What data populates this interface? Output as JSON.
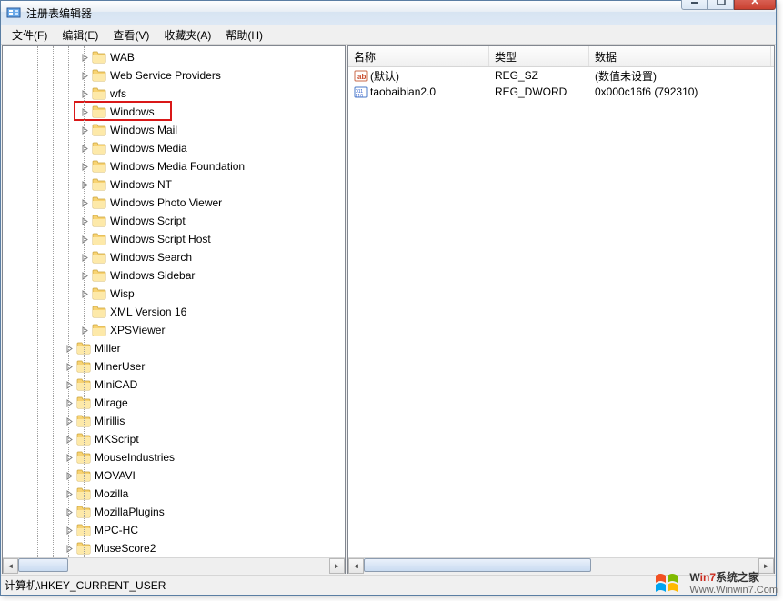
{
  "window": {
    "title": "注册表编辑器"
  },
  "menu": {
    "file": "文件(F)",
    "edit": "编辑(E)",
    "view": "查看(V)",
    "favorites": "收藏夹(A)",
    "help": "帮助(H)"
  },
  "tree": {
    "items": [
      {
        "indent": 85,
        "label": "WAB",
        "expandable": true
      },
      {
        "indent": 85,
        "label": "Web Service Providers",
        "expandable": true
      },
      {
        "indent": 85,
        "label": "wfs",
        "expandable": true
      },
      {
        "indent": 85,
        "label": "Windows",
        "expandable": true,
        "highlighted": true
      },
      {
        "indent": 85,
        "label": "Windows Mail",
        "expandable": true
      },
      {
        "indent": 85,
        "label": "Windows Media",
        "expandable": true
      },
      {
        "indent": 85,
        "label": "Windows Media Foundation",
        "expandable": true
      },
      {
        "indent": 85,
        "label": "Windows NT",
        "expandable": true
      },
      {
        "indent": 85,
        "label": "Windows Photo Viewer",
        "expandable": true
      },
      {
        "indent": 85,
        "label": "Windows Script",
        "expandable": true
      },
      {
        "indent": 85,
        "label": "Windows Script Host",
        "expandable": true
      },
      {
        "indent": 85,
        "label": "Windows Search",
        "expandable": true
      },
      {
        "indent": 85,
        "label": "Windows Sidebar",
        "expandable": true
      },
      {
        "indent": 85,
        "label": "Wisp",
        "expandable": true
      },
      {
        "indent": 85,
        "label": "XML Version 16",
        "expandable": false
      },
      {
        "indent": 85,
        "label": "XPSViewer",
        "expandable": true
      },
      {
        "indent": 68,
        "label": "Miller",
        "expandable": true
      },
      {
        "indent": 68,
        "label": "MinerUser",
        "expandable": true
      },
      {
        "indent": 68,
        "label": "MiniCAD",
        "expandable": true
      },
      {
        "indent": 68,
        "label": "Mirage",
        "expandable": true
      },
      {
        "indent": 68,
        "label": "Mirillis",
        "expandable": true
      },
      {
        "indent": 68,
        "label": "MKScript",
        "expandable": true
      },
      {
        "indent": 68,
        "label": "MouseIndustries",
        "expandable": true
      },
      {
        "indent": 68,
        "label": "MOVAVI",
        "expandable": true
      },
      {
        "indent": 68,
        "label": "Mozilla",
        "expandable": true
      },
      {
        "indent": 68,
        "label": "MozillaPlugins",
        "expandable": true
      },
      {
        "indent": 68,
        "label": "MPC-HC",
        "expandable": true
      },
      {
        "indent": 68,
        "label": "MuseScore2",
        "expandable": true
      }
    ]
  },
  "list": {
    "columns": {
      "name": "名称",
      "type": "类型",
      "data": "数据"
    },
    "col_widths": {
      "name": 155,
      "type": 110,
      "data": 200
    },
    "rows": [
      {
        "icon": "string",
        "name": "(默认)",
        "type": "REG_SZ",
        "data": "(数值未设置)"
      },
      {
        "icon": "binary",
        "name": "taobaibian2.0",
        "type": "REG_DWORD",
        "data": "0x000c16f6 (792310)"
      }
    ]
  },
  "status": {
    "path": "计算机\\HKEY_CURRENT_USER"
  },
  "watermark": {
    "line1a": "W",
    "line1b": "in7",
    "line1c": "系统之家",
    "line2": "Www.Winwin7.Com"
  }
}
